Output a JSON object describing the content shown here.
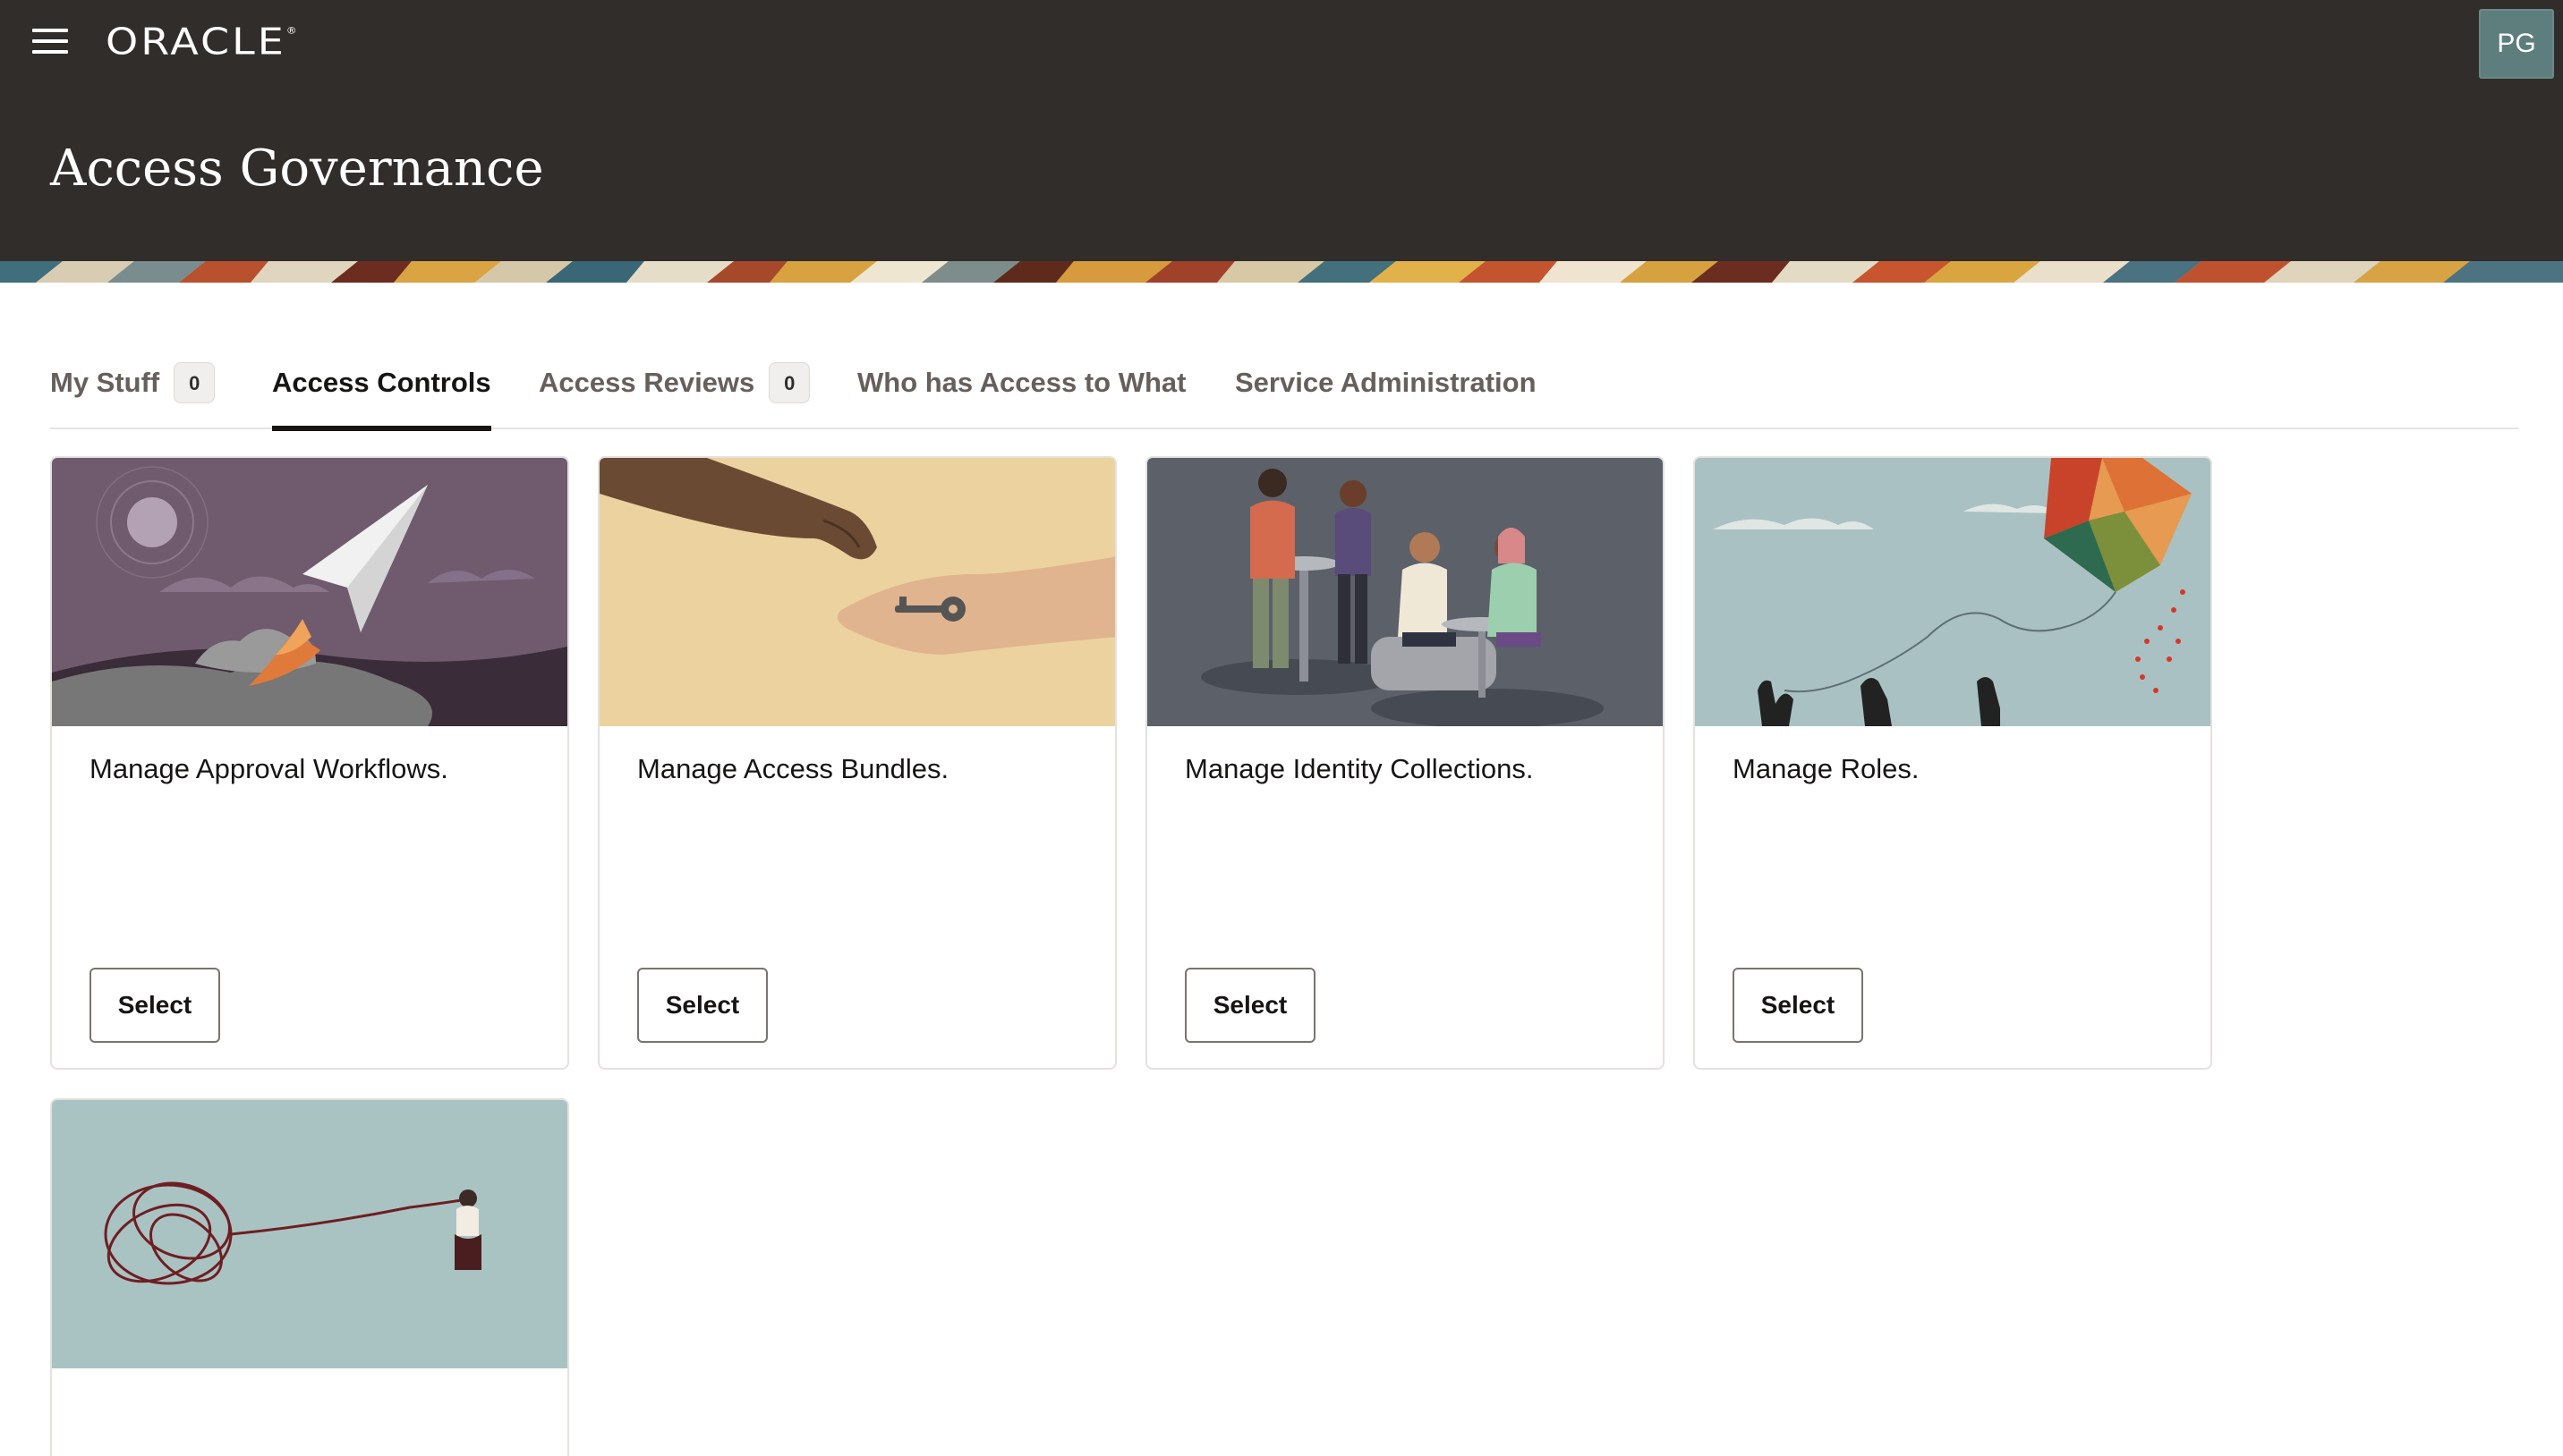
{
  "header": {
    "logo_text": "ORACLE",
    "logo_mark": "®",
    "title": "Access Governance",
    "avatar_initials": "PG",
    "background_color": "#312d2a",
    "icons": {
      "menu": "hamburger-menu-icon"
    }
  },
  "tabs": [
    {
      "label": "My Stuff",
      "badge": "0",
      "active": false
    },
    {
      "label": "Access Controls",
      "active": true
    },
    {
      "label": "Access Reviews",
      "badge": "0",
      "active": false
    },
    {
      "label": "Who has Access to What",
      "active": false
    },
    {
      "label": "Service Administration",
      "active": false
    }
  ],
  "cards": [
    {
      "title": "Manage Approval Workflows.",
      "button": "Select",
      "illustration": "paper-plane-illustration"
    },
    {
      "title": "Manage Access Bundles.",
      "button": "Select",
      "illustration": "key-handoff-illustration"
    },
    {
      "title": "Manage Identity Collections.",
      "button": "Select",
      "illustration": "people-group-illustration"
    },
    {
      "title": "Manage Roles.",
      "button": "Select",
      "illustration": "kite-illustration"
    },
    {
      "illustration": "tangled-string-illustration"
    }
  ]
}
